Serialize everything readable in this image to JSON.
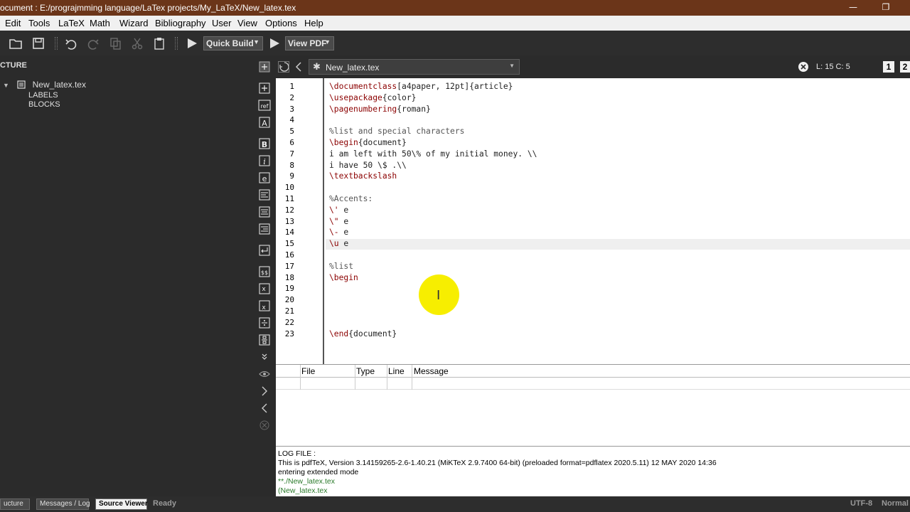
{
  "window": {
    "title": "ocument : E:/prograjmming language/LaTex projects/My_LaTeX/New_latex.tex",
    "minimize_glyph": "—",
    "restore_glyph": "❐"
  },
  "menu": [
    "Edit",
    "Tools",
    "LaTeX",
    "Math",
    "Wizard",
    "Bibliography",
    "User",
    "View",
    "Options",
    "Help"
  ],
  "toolbar": {
    "quick_build_label": "Quick Build",
    "view_pdf_label": "View PDF",
    "icons": [
      "open-folder-icon",
      "save-icon",
      "undo-icon",
      "redo-icon",
      "copy-icon",
      "cut-icon",
      "paste-icon",
      "run-icon",
      "run-icon"
    ]
  },
  "structure": {
    "header": "CTURE",
    "root_label": "New_latex.tex",
    "children": [
      "LABELS",
      "BLOCKS"
    ]
  },
  "tabbar": {
    "tab_label": "New_latex.tex",
    "cursor_position": "L: 15 C: 5",
    "view_buttons": [
      "1",
      "2"
    ]
  },
  "editor": {
    "line_numbers": [
      "1",
      "2",
      "3",
      "4",
      "5",
      "6",
      "7",
      "8",
      "9",
      "10",
      "11",
      "12",
      "13",
      "14",
      "15",
      "16",
      "17",
      "18",
      "19",
      "20",
      "21",
      "22",
      "23"
    ],
    "lines": [
      {
        "cmd": "\\documentclass",
        "rest": "[a4paper, 12pt]{article}"
      },
      {
        "cmd": "\\usepackage",
        "rest": "{color}"
      },
      {
        "cmd": "\\pagenumbering",
        "rest": "{roman}"
      },
      {
        "cmd": "",
        "rest": ""
      },
      {
        "cmd": "",
        "rest": "%list and special characters"
      },
      {
        "cmd": "\\begin",
        "rest": "{document}"
      },
      {
        "cmd": "",
        "rest": "i am left with 50\\% of my initial money. \\\\"
      },
      {
        "cmd": "",
        "rest": "i have 50 \\$ .\\\\"
      },
      {
        "cmd": "\\textbackslash",
        "rest": ""
      },
      {
        "cmd": "",
        "rest": ""
      },
      {
        "cmd": "",
        "rest": "%Accents:"
      },
      {
        "cmd": "\\'",
        "rest": " e"
      },
      {
        "cmd": "\\\"",
        "rest": " e"
      },
      {
        "cmd": "\\-",
        "rest": " e"
      },
      {
        "cmd": "\\u",
        "rest": " e"
      },
      {
        "cmd": "",
        "rest": ""
      },
      {
        "cmd": "",
        "rest": "%list"
      },
      {
        "cmd": "\\begin",
        "rest": ""
      },
      {
        "cmd": "",
        "rest": ""
      },
      {
        "cmd": "",
        "rest": ""
      },
      {
        "cmd": "",
        "rest": ""
      },
      {
        "cmd": "",
        "rest": ""
      },
      {
        "cmd": "\\end",
        "rest": "{document}"
      }
    ]
  },
  "messages": {
    "columns": [
      "File",
      "Type",
      "Line",
      "Message"
    ]
  },
  "log": {
    "header": "LOG FILE :",
    "lines": [
      "This is pdfTeX, Version 3.14159265-2.6-1.40.21 (MiKTeX 2.9.7400 64-bit) (preloaded format=pdflatex 2020.5.11) 12 MAY 2020 14:36",
      "entering extended mode",
      "**./New_latex.tex",
      "(New_latex.tex"
    ]
  },
  "statusbar": {
    "structure_btn": "ucture",
    "messages_btn": "Messages / Log",
    "source_viewer_btn": "Source Viewer",
    "status": "Ready",
    "encoding": "UTF-8",
    "mode": "Normal"
  },
  "colors": {
    "title_bar": "#6b3519",
    "toolbar": "#2d2d2d",
    "panel": "#2b2b2b",
    "command": "#8b0000",
    "log_green": "#2a7a2a",
    "mouse_highlight": "#f7ee00"
  }
}
